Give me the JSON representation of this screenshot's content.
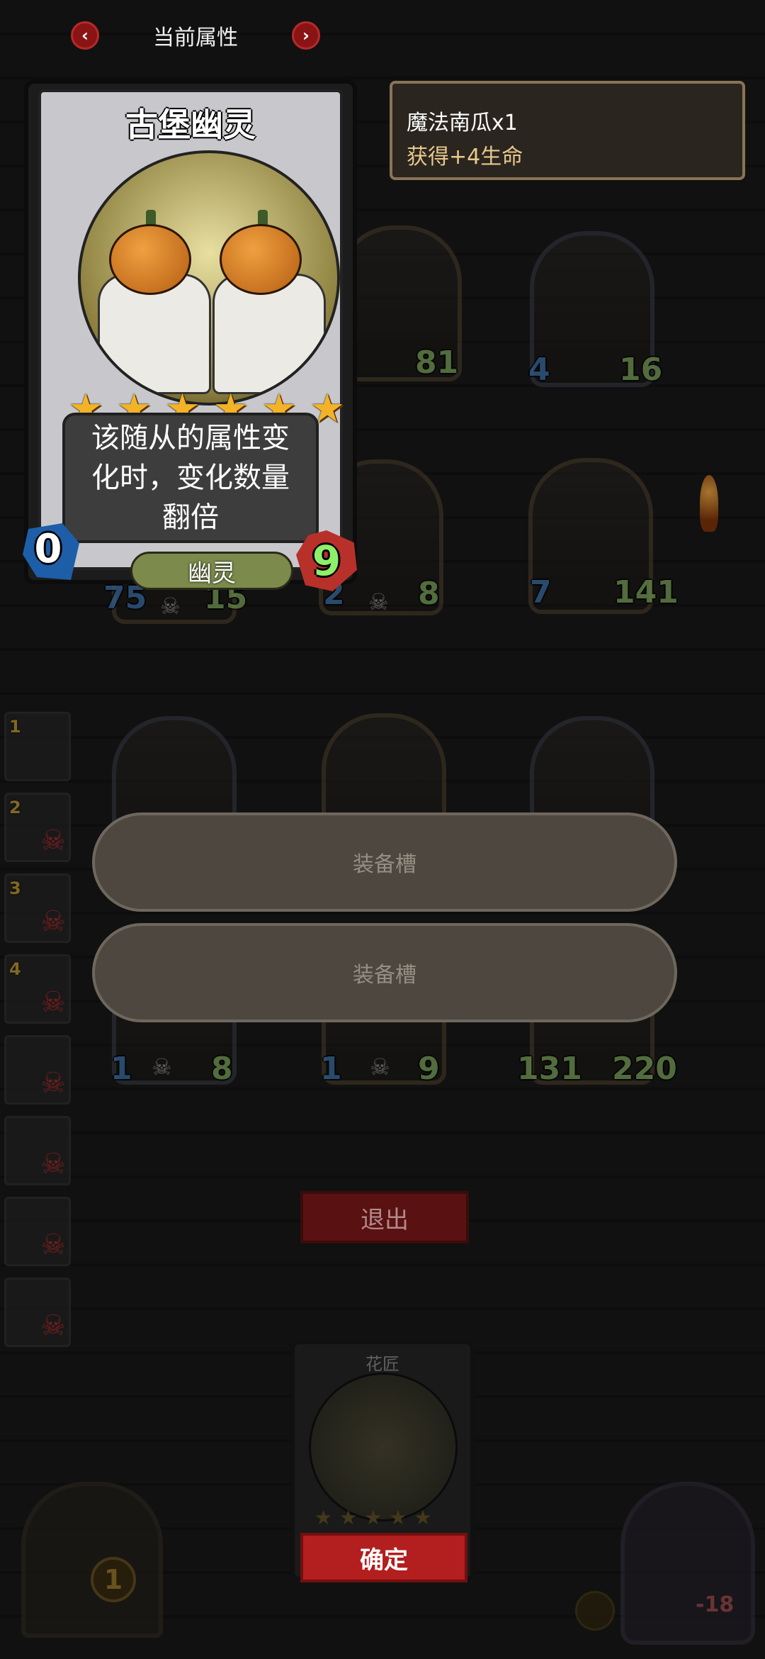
{
  "nav": {
    "title": "当前属性",
    "prev_icon": "chevron-left-icon",
    "next_icon": "chevron-right-icon"
  },
  "detail_card": {
    "name": "古堡幽灵",
    "stars": 6,
    "description": "该随从的属性变化时，变化数量翻倍",
    "cost": "0",
    "type": "幽灵",
    "health": "9"
  },
  "info": {
    "line1": "魔法南瓜x1",
    "line2": "获得+4生命"
  },
  "board": {
    "row1": [
      {
        "atk": "",
        "hp": "81"
      },
      {
        "atk": "4",
        "hp": "16"
      }
    ],
    "row2": [
      {
        "atk": "75",
        "hp": "15"
      },
      {
        "atk": "2",
        "hp": "8"
      },
      {
        "atk": "7",
        "hp": "141"
      }
    ],
    "row4": [
      {
        "atk": "1",
        "hp": "8"
      },
      {
        "atk": "1",
        "hp": "9"
      },
      {
        "atk": "131",
        "hp": "220"
      }
    ]
  },
  "sidebar": {
    "slots": [
      {
        "num": "1"
      },
      {
        "num": "2"
      },
      {
        "num": "3"
      },
      {
        "num": "4"
      },
      {
        "num": ""
      },
      {
        "num": ""
      },
      {
        "num": ""
      },
      {
        "num": ""
      }
    ]
  },
  "equipment": {
    "slot1_label": "装备槽",
    "slot2_label": "装备槽"
  },
  "exit_label": "退出",
  "bottom_card": {
    "name": "花匠",
    "confirm_label": "确定"
  },
  "footer": {
    "coin_value": "1",
    "boss_value": "-18"
  }
}
